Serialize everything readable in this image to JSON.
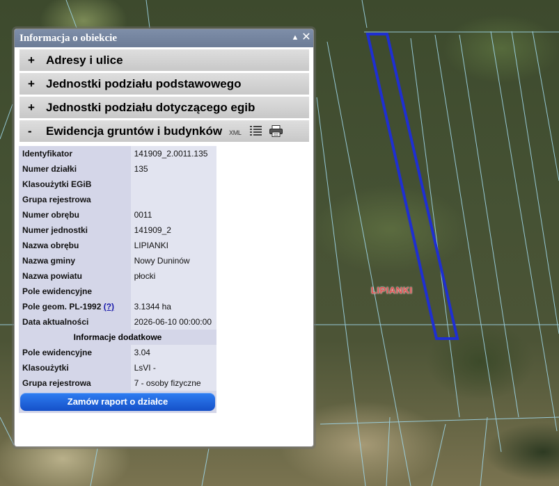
{
  "map": {
    "place_label": "LIPIANKI"
  },
  "panel": {
    "title": "Informacja o obiekcie",
    "collapse_glyph": "▲",
    "close_glyph": "✕"
  },
  "sections": [
    {
      "toggle": "+",
      "label": "Adresy i ulice"
    },
    {
      "toggle": "+",
      "label": "Jednostki podziału podstawowego"
    },
    {
      "toggle": "+",
      "label": "Jednostki podziału dotyczącego egib"
    },
    {
      "toggle": "-",
      "label": "Ewidencja gruntów i budynków",
      "xml_label": "XML",
      "list_icon": "list-icon",
      "print_icon": "printer-icon"
    }
  ],
  "attributes": [
    {
      "key": "Identyfikator",
      "value": "141909_2.0011.135"
    },
    {
      "key": "Numer działki",
      "value": "135"
    },
    {
      "key": "Klasoużytki EGiB",
      "value": ""
    },
    {
      "key": "Grupa rejestrowa",
      "value": ""
    },
    {
      "key": "Numer obrębu",
      "value": "0011"
    },
    {
      "key": "Numer jednostki",
      "value": "141909_2"
    },
    {
      "key": "Nazwa obrębu",
      "value": "LIPIANKI"
    },
    {
      "key": "Nazwa gminy",
      "value": "Nowy Duninów"
    },
    {
      "key": "Nazwa powiatu",
      "value": "płocki"
    },
    {
      "key": "Pole ewidencyjne",
      "value": ""
    },
    {
      "key": "Pole geom. PL-1992",
      "help": "(?)",
      "value": "3.1344 ha"
    },
    {
      "key": "Data aktualności",
      "value": "2026-06-10 00:00:00"
    }
  ],
  "additional": {
    "header": "Informacje dodatkowe",
    "rows": [
      {
        "key": "Pole ewidencyjne",
        "value": "3.04"
      },
      {
        "key": "Klasoużytki",
        "value": "LsVI -"
      },
      {
        "key": "Grupa rejestrowa",
        "value": "7 - osoby fizyczne"
      }
    ]
  },
  "report_button": "Zamów raport o działce",
  "colors": {
    "parcel_outline": "#1f2fd0",
    "boundary_lines": "#9fd6e8",
    "report_button": "#1f63e0"
  }
}
